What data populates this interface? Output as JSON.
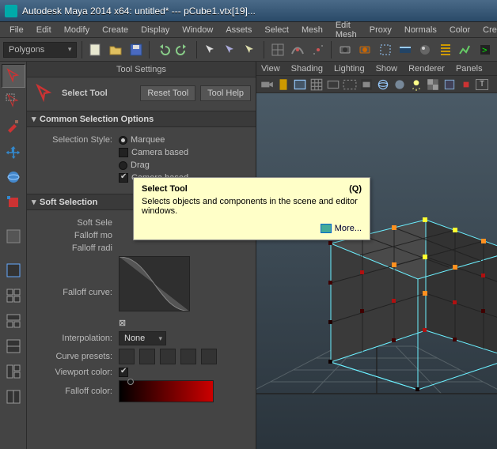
{
  "titlebar": {
    "text": "Autodesk Maya 2014 x64: untitled*   ---   pCube1.vtx[19]..."
  },
  "menubar": [
    "File",
    "Edit",
    "Modify",
    "Create",
    "Display",
    "Window",
    "Assets",
    "Select",
    "Mesh",
    "Edit Mesh",
    "Proxy",
    "Normals",
    "Color",
    "Create"
  ],
  "shelf": {
    "mode": "Polygons"
  },
  "panel": {
    "title": "Tool Settings",
    "tool_label": "Select Tool",
    "reset_btn": "Reset Tool",
    "help_btn": "Tool Help",
    "section1": {
      "title": "Common Selection Options",
      "sel_style": "Selection Style:",
      "marquee": "Marquee",
      "camera1": "Camera based",
      "drag": "Drag",
      "camera2": "Camera based"
    },
    "section2": {
      "title": "Soft Selection",
      "soft_sel": "Soft Sele",
      "falloff_mode": "Falloff mo",
      "falloff_radius": "Falloff radi",
      "falloff_curve": "Falloff curve:",
      "interpolation": "Interpolation:",
      "interp_value": "None",
      "curve_presets": "Curve presets:",
      "viewport_color": "Viewport color:",
      "falloff_color": "Falloff color:"
    }
  },
  "viewport_menu": [
    "View",
    "Shading",
    "Lighting",
    "Show",
    "Renderer",
    "Panels"
  ],
  "tooltip": {
    "title": "Select Tool",
    "shortcut": "(Q)",
    "body": "Selects objects and components in the scene and editor windows.",
    "more": "More..."
  }
}
